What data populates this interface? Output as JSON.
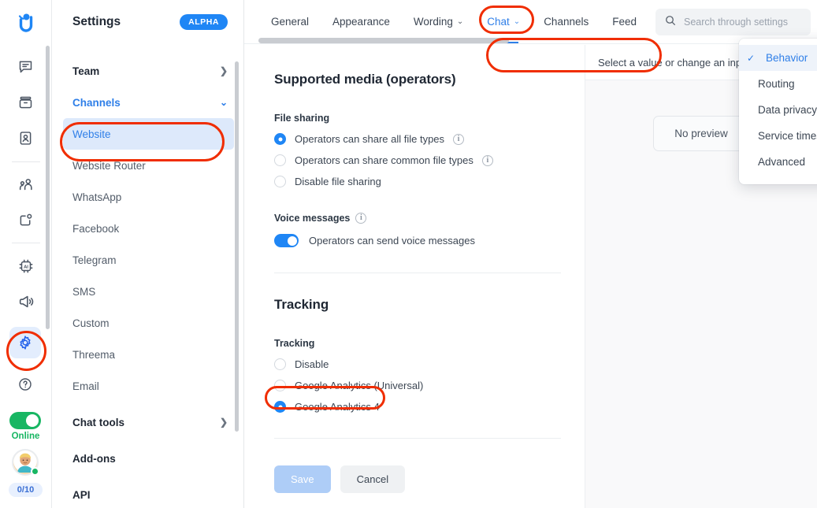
{
  "app": {
    "logo_name": "userlike-logo"
  },
  "rail": {
    "icons": [
      {
        "name": "messages-icon",
        "label": "Messages"
      },
      {
        "name": "archive-icon",
        "label": "Archive"
      },
      {
        "name": "contacts-icon",
        "label": "Contacts"
      },
      {
        "name": "team-icon",
        "label": "Team"
      },
      {
        "name": "tasks-icon",
        "label": "Tasks"
      },
      {
        "name": "ai-chip-icon",
        "label": "AI Automation"
      },
      {
        "name": "megaphone-icon",
        "label": "Announcements"
      }
    ],
    "settings_icon": "gear-icon",
    "help_icon": "question-circle-icon",
    "status_label": "Online",
    "capacity": "0/10"
  },
  "settings": {
    "title": "Settings",
    "badge": "ALPHA",
    "nav": [
      {
        "label": "Team",
        "type": "group",
        "chevron": "chevron-right"
      },
      {
        "label": "Channels",
        "type": "group-open",
        "chevron": "chevron-down"
      },
      {
        "label": "Website",
        "type": "child-selected"
      },
      {
        "label": "Website Router",
        "type": "child"
      },
      {
        "label": "WhatsApp",
        "type": "child"
      },
      {
        "label": "Facebook",
        "type": "child"
      },
      {
        "label": "Telegram",
        "type": "child"
      },
      {
        "label": "SMS",
        "type": "child"
      },
      {
        "label": "Custom",
        "type": "child"
      },
      {
        "label": "Threema",
        "type": "child"
      },
      {
        "label": "Email",
        "type": "child"
      },
      {
        "label": "Chat tools",
        "type": "group",
        "chevron": "chevron-right"
      },
      {
        "label": "Add-ons",
        "type": "group"
      },
      {
        "label": "API",
        "type": "group"
      }
    ]
  },
  "tabs": [
    {
      "label": "General",
      "has_caret": false,
      "active": false
    },
    {
      "label": "Appearance",
      "has_caret": false,
      "active": false
    },
    {
      "label": "Wording",
      "has_caret": true,
      "active": false
    },
    {
      "label": "Chat",
      "has_caret": true,
      "active": true
    },
    {
      "label": "Channels",
      "has_caret": false,
      "active": false
    },
    {
      "label": "Feed",
      "has_caret": false,
      "active": false
    }
  ],
  "search": {
    "placeholder": "Search through settings",
    "value": "",
    "icon": "search-icon"
  },
  "dropdown": {
    "items": [
      {
        "label": "Behavior",
        "selected": true
      },
      {
        "label": "Routing",
        "selected": false
      },
      {
        "label": "Data privacy",
        "selected": false
      },
      {
        "label": "Service times",
        "selected": false
      },
      {
        "label": "Advanced",
        "selected": false
      }
    ]
  },
  "content": {
    "section_media_title": "Supported media (operators)",
    "file_sharing_label": "File sharing",
    "file_sharing_options": [
      {
        "label": "Operators can share all file types",
        "selected": true,
        "info": true
      },
      {
        "label": "Operators can share common file types",
        "selected": false,
        "info": true
      },
      {
        "label": "Disable file sharing",
        "selected": false,
        "info": false
      }
    ],
    "voice_label": "Voice messages",
    "voice_toggle_label": "Operators can send voice messages",
    "voice_toggle_on": true,
    "section_tracking_title": "Tracking",
    "tracking_label": "Tracking",
    "tracking_options": [
      {
        "label": "Disable",
        "selected": false
      },
      {
        "label": "Google Analytics (Universal)",
        "selected": false
      },
      {
        "label": "Google Analytics 4",
        "selected": true
      }
    ],
    "save_label": "Save",
    "cancel_label": "Cancel"
  },
  "preview": {
    "select_label": "Select a value or change an input",
    "select_caret": "chevron-down-icon",
    "empty_label": "No preview"
  },
  "annotations": {
    "color": "#f02d00",
    "count": 4
  }
}
